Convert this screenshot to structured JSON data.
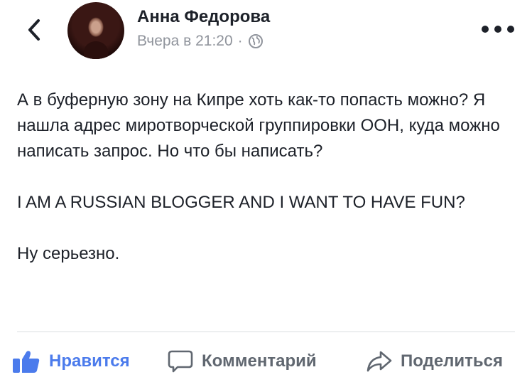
{
  "header": {
    "author_name": "Анна Федорова",
    "timestamp": "Вчера в 21:20",
    "separator": "·",
    "privacy_icon": "globe-icon",
    "back_icon": "chevron-left-icon",
    "more_icon": "more-horizontal-icon"
  },
  "post": {
    "paragraph_1": "А в буферную зону на Кипре хоть как-то попасть можно? Я нашла адрес миротворческой группировки ООН, куда можно написать запрос. Но что бы написать?",
    "paragraph_2": "I AM A RUSSIAN BLOGGER AND I WANT TO HAVE FUN?",
    "paragraph_3": "Ну серьезно."
  },
  "actions": {
    "like_label": "Нравится",
    "comment_label": "Комментарий",
    "share_label": "Поделиться"
  },
  "colors": {
    "like_blue": "#4b7bec",
    "action_grey": "#606770",
    "meta_grey": "#90949c",
    "text_dark": "#1d2129"
  }
}
